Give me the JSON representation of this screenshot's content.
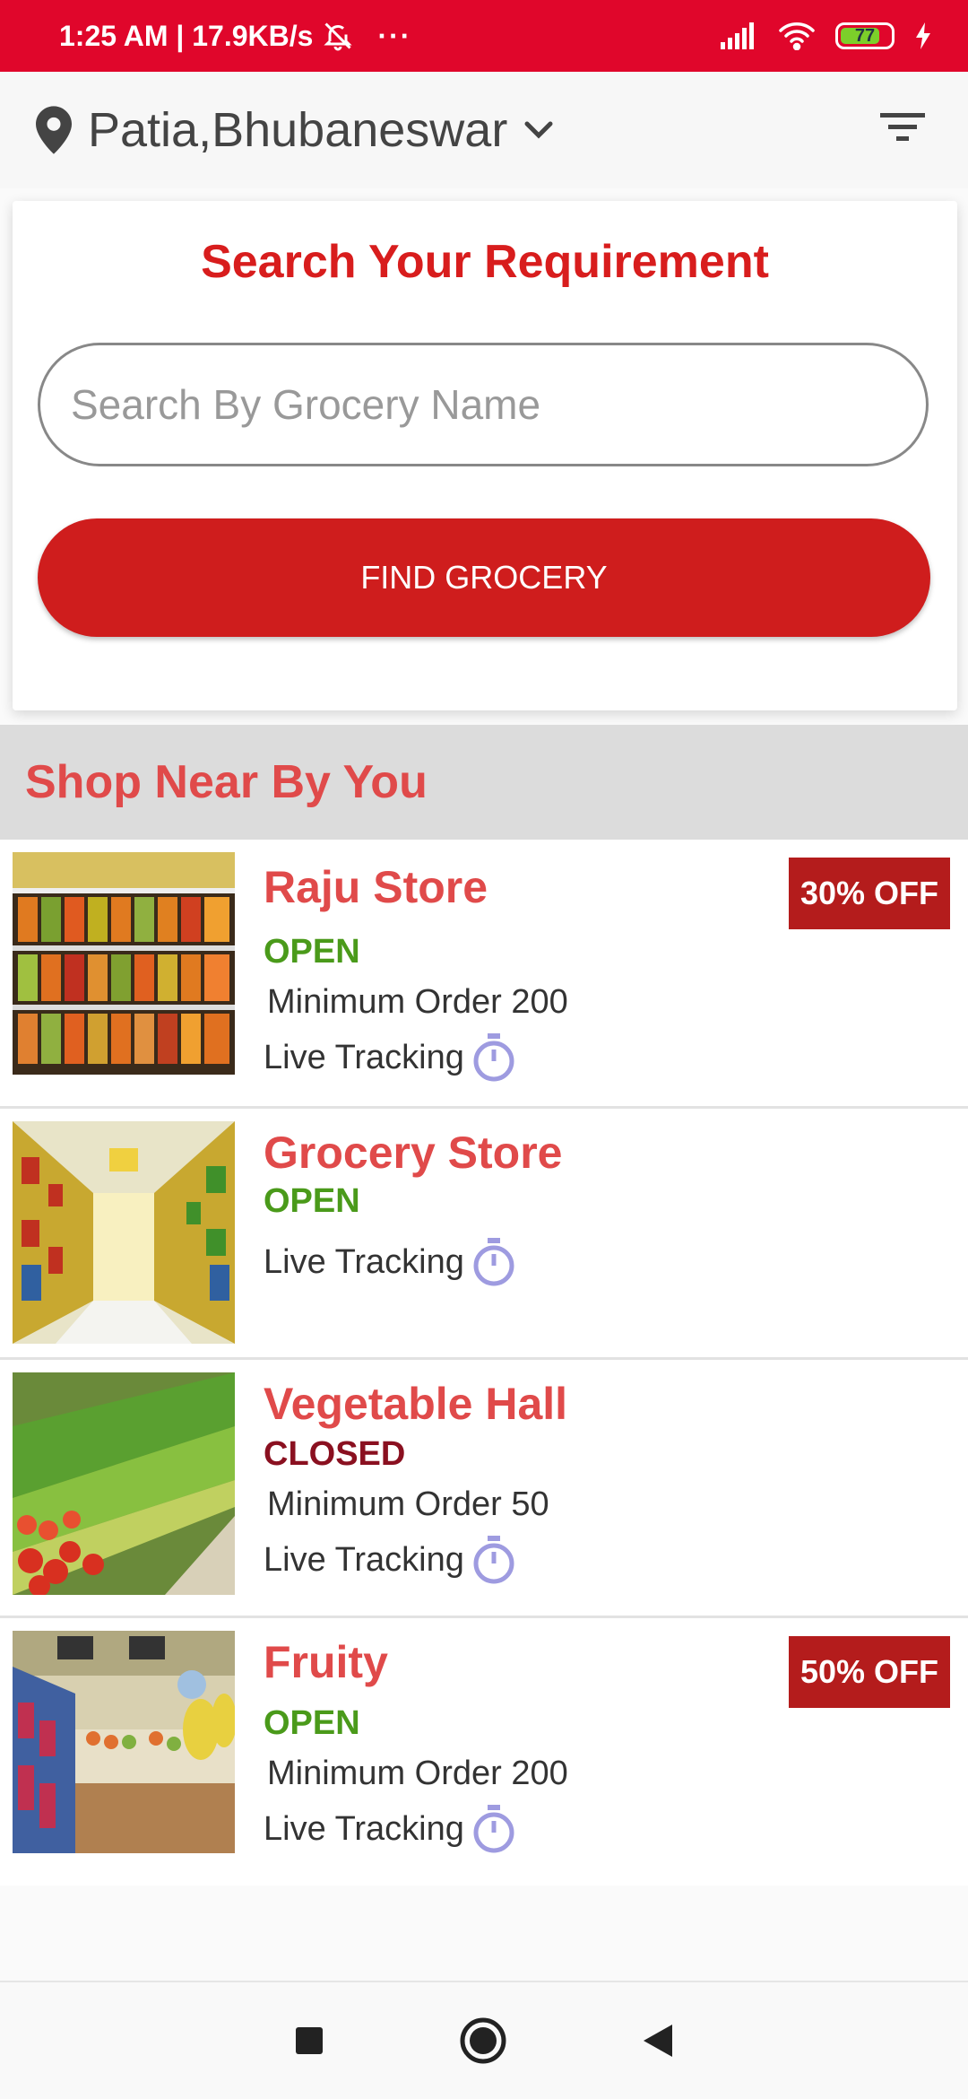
{
  "status_bar": {
    "time_info": "1:25 AM | 17.9KB/s",
    "dots": "···",
    "battery_level": "77",
    "bg_color": "#e0062b"
  },
  "location": {
    "text": "Patia,Bhubaneswar"
  },
  "search": {
    "title": "Search Your Requirement",
    "placeholder": "Search By Grocery Name",
    "value": "",
    "button_label": "FIND GROCERY"
  },
  "section": {
    "title": "Shop Near By You"
  },
  "shops": [
    {
      "name": "Raju Store",
      "status": "OPEN",
      "min_order": "Minimum Order 200",
      "tracking": "Live Tracking",
      "discount": "30% OFF"
    },
    {
      "name": "Grocery Store",
      "status": "OPEN",
      "tracking": "Live Tracking"
    },
    {
      "name": "Vegetable Hall",
      "status": "CLOSED",
      "min_order": "Minimum Order 50",
      "tracking": "Live Tracking"
    },
    {
      "name": "Fruity",
      "status": "OPEN",
      "min_order": "Minimum Order 200",
      "tracking": "Live Tracking",
      "discount": "50% OFF"
    }
  ],
  "colors": {
    "accent": "#d81d1d",
    "open": "#4a9a1a",
    "closed": "#8a1020",
    "timer_icon": "#9e9be0"
  },
  "icons": [
    "location-pin-icon",
    "chevron-down-icon",
    "filter-icon",
    "timer-icon",
    "bell-off-icon",
    "signal-icon",
    "wifi-icon",
    "battery-icon",
    "charging-icon",
    "nav-recents-icon",
    "nav-home-icon",
    "nav-back-icon"
  ]
}
